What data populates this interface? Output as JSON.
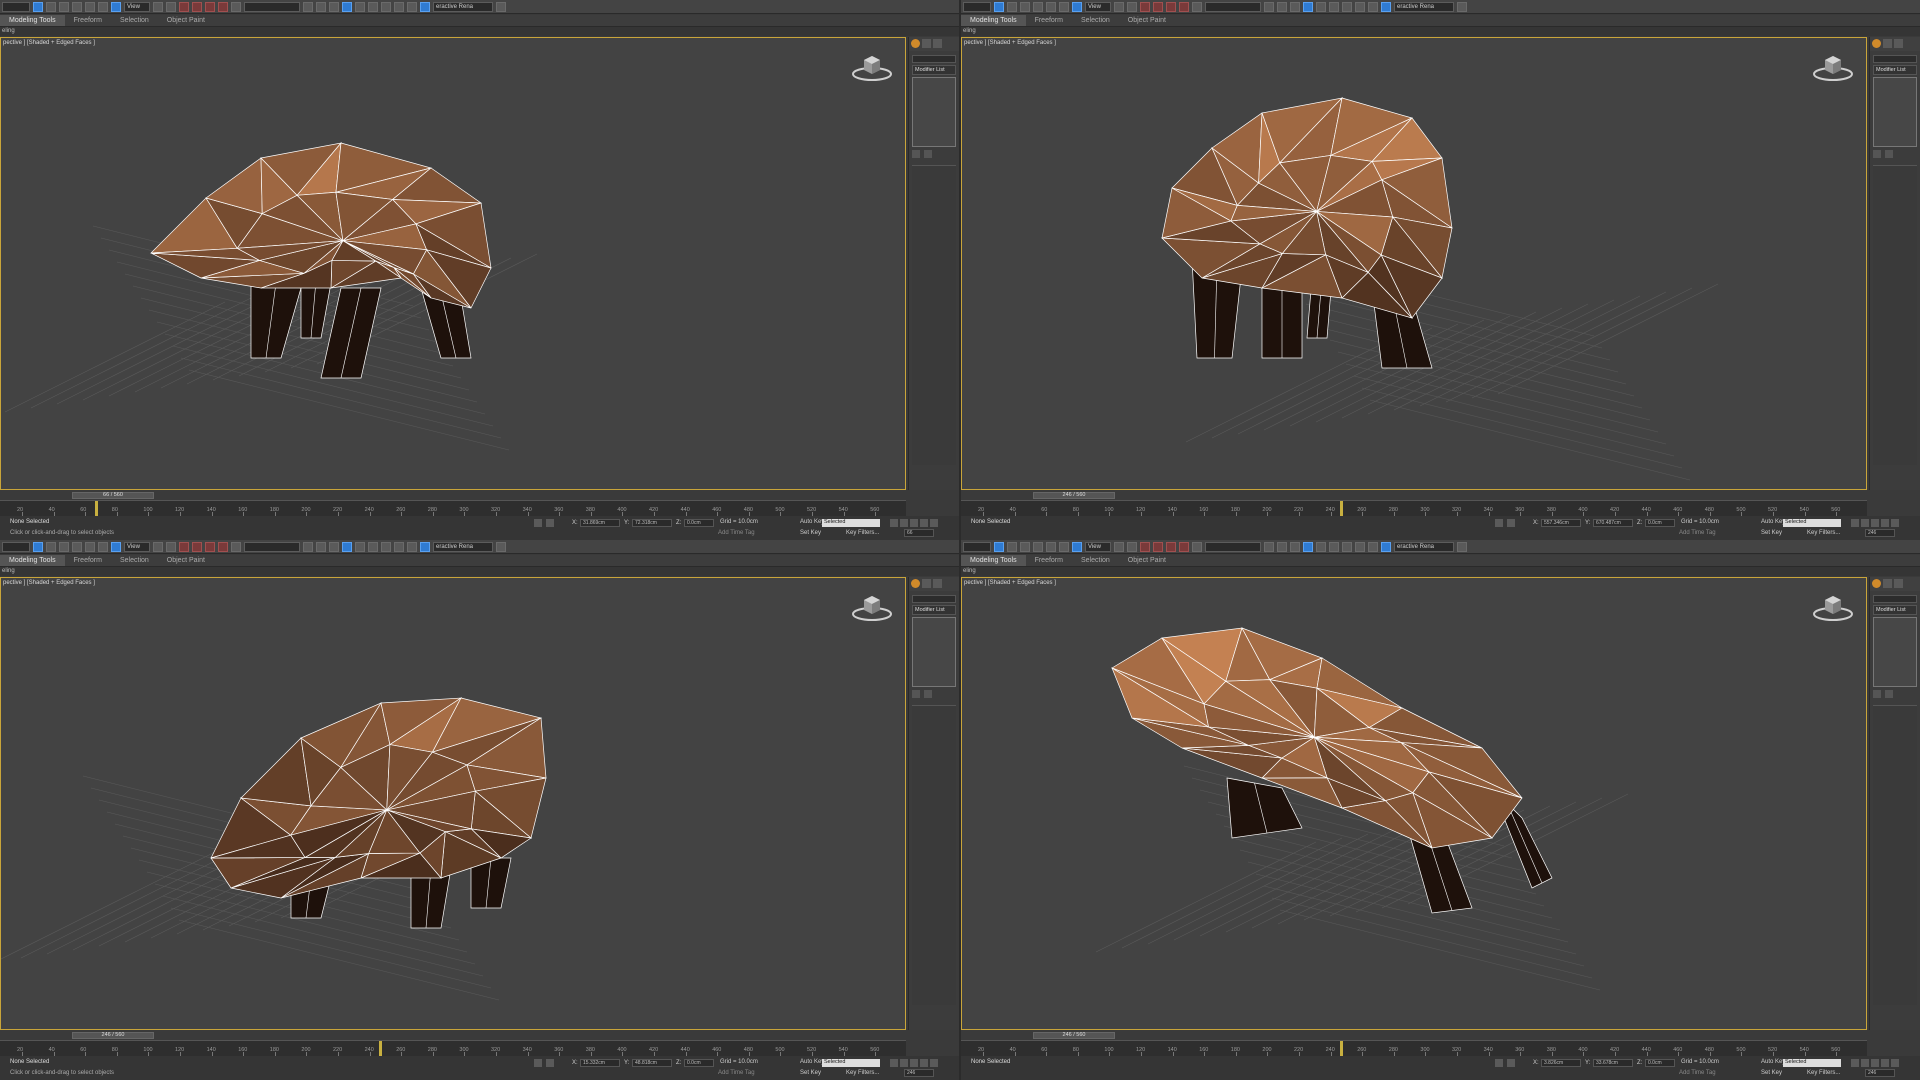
{
  "toolbar": {
    "view_dropdown": "View",
    "interactive_render": "eractive Rena"
  },
  "ribbon": {
    "tabs": [
      "Modeling Tools",
      "Freeform",
      "Selection",
      "Object Paint"
    ],
    "sub_label": "eling"
  },
  "viewports": [
    {
      "label": "pective ] [Shaded + Edged Faces ]",
      "frame": "66 / 560",
      "status": "None Selected",
      "status2": "Click or click-and-drag to select objects",
      "x": "31.869cm",
      "y": "72.318cm",
      "z": "0.0cm",
      "grid": "Grid = 10.0cm",
      "add_time_tag": "Add Time Tag",
      "frame_field": "66",
      "rotation": 0
    },
    {
      "label": "pective ] [Shaded + Edged Faces ]",
      "frame": "246 / 560",
      "status": "None Selected",
      "status2": "",
      "x": "557.346cm",
      "y": "670.487cm",
      "z": "0.0cm",
      "grid": "Grid = 10.0cm",
      "add_time_tag": "Add Time Tag",
      "frame_field": "246",
      "rotation": 1
    },
    {
      "label": "pective ] [Shaded + Edged Faces ]",
      "frame": "246 / 560",
      "status": "None Selected",
      "status2": "Click or click-and-drag to select objects",
      "x": "15.332cm",
      "y": "48.818cm",
      "z": "0.0cm",
      "grid": "Grid = 10.0cm",
      "add_time_tag": "Add Time Tag",
      "frame_field": "246",
      "rotation": 2
    },
    {
      "label": "pective ] [Shaded + Edged Faces ]",
      "frame": "246 / 560",
      "status": "None Selected",
      "status2": "",
      "x": "3.826cm",
      "y": "33.678cm",
      "z": "0.0cm",
      "grid": "Grid = 10.0cm",
      "add_time_tag": "Add Time Tag",
      "frame_field": "246",
      "rotation": 3
    }
  ],
  "command_panel": {
    "modifier_list": "Modifier List"
  },
  "timeline": {
    "ticks": [
      "20",
      "40",
      "60",
      "80",
      "100",
      "120",
      "140",
      "160",
      "180",
      "200",
      "220",
      "240",
      "260",
      "280",
      "300",
      "320",
      "340",
      "360",
      "380",
      "400",
      "420",
      "440",
      "460",
      "480",
      "500",
      "520",
      "540",
      "560"
    ]
  },
  "anim": {
    "auto_key": "Auto Key",
    "set_key": "Set Key",
    "selected": "Selected",
    "key_filters": "Key Filters..."
  },
  "colors": {
    "accent_border": "#c9a53a",
    "active_blue": "#2f7bd2",
    "boar_light": "#c89a66",
    "boar_dark": "#2a1710",
    "edge": "#ffffff"
  }
}
